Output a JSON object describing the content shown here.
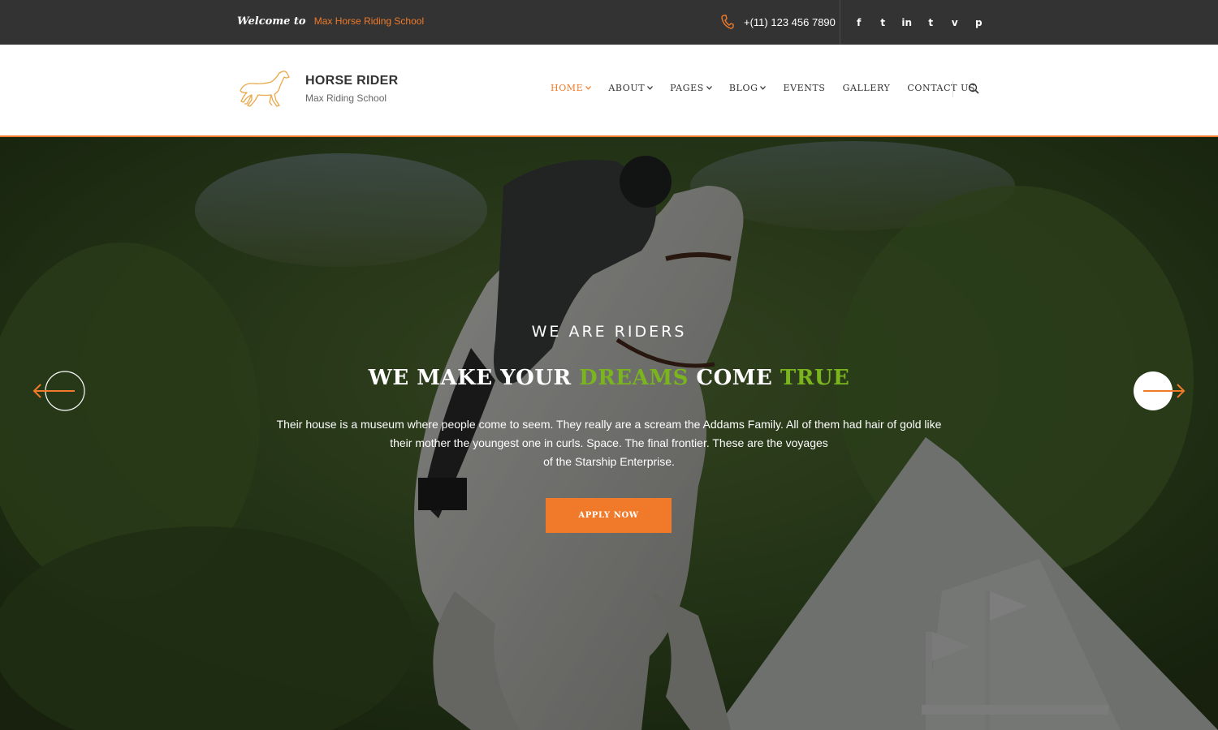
{
  "topbar": {
    "welcome_script": "Welcome to",
    "school_name": "Max Horse Riding School",
    "phone": "+(11) 123 456 7890",
    "socials": [
      {
        "icon": "facebook-icon",
        "glyph": "f"
      },
      {
        "icon": "twitter-icon",
        "glyph": "t"
      },
      {
        "icon": "linkedin-icon",
        "glyph": "in"
      },
      {
        "icon": "tumblr-icon",
        "glyph": "t"
      },
      {
        "icon": "vimeo-icon",
        "glyph": "v"
      },
      {
        "icon": "pinterest-icon",
        "glyph": "p"
      }
    ]
  },
  "header": {
    "brand_title": "HORSE RIDER",
    "brand_subtitle": "Max Riding School",
    "nav": [
      {
        "label": "HOME",
        "dropdown": true,
        "active": true
      },
      {
        "label": "ABOUT",
        "dropdown": true,
        "active": false
      },
      {
        "label": "PAGES",
        "dropdown": true,
        "active": false
      },
      {
        "label": "BLOG",
        "dropdown": true,
        "active": false
      },
      {
        "label": "EVENTS",
        "dropdown": false,
        "active": false
      },
      {
        "label": "GALLERY",
        "dropdown": false,
        "active": false
      },
      {
        "label": "CONTACT US",
        "dropdown": false,
        "active": false
      }
    ]
  },
  "hero": {
    "eyebrow": "WE ARE RIDERS",
    "headline": {
      "part1": "WE MAKE YOUR ",
      "highlight1": "DREAMS",
      "part2": " COME ",
      "highlight2": "TRUE"
    },
    "description_lines": [
      "Their house is a museum where people come to seem. They really are a scream the Addams Family. All of them had hair of gold like",
      "their mother the youngest one in curls. Space. The final frontier. These are the voyages",
      "of the Starship Enterprise."
    ],
    "cta_label": "APPLY NOW"
  },
  "colors": {
    "accent": "#f07a2a",
    "highlight": "#7ab51d",
    "topbar_bg": "#333333"
  }
}
